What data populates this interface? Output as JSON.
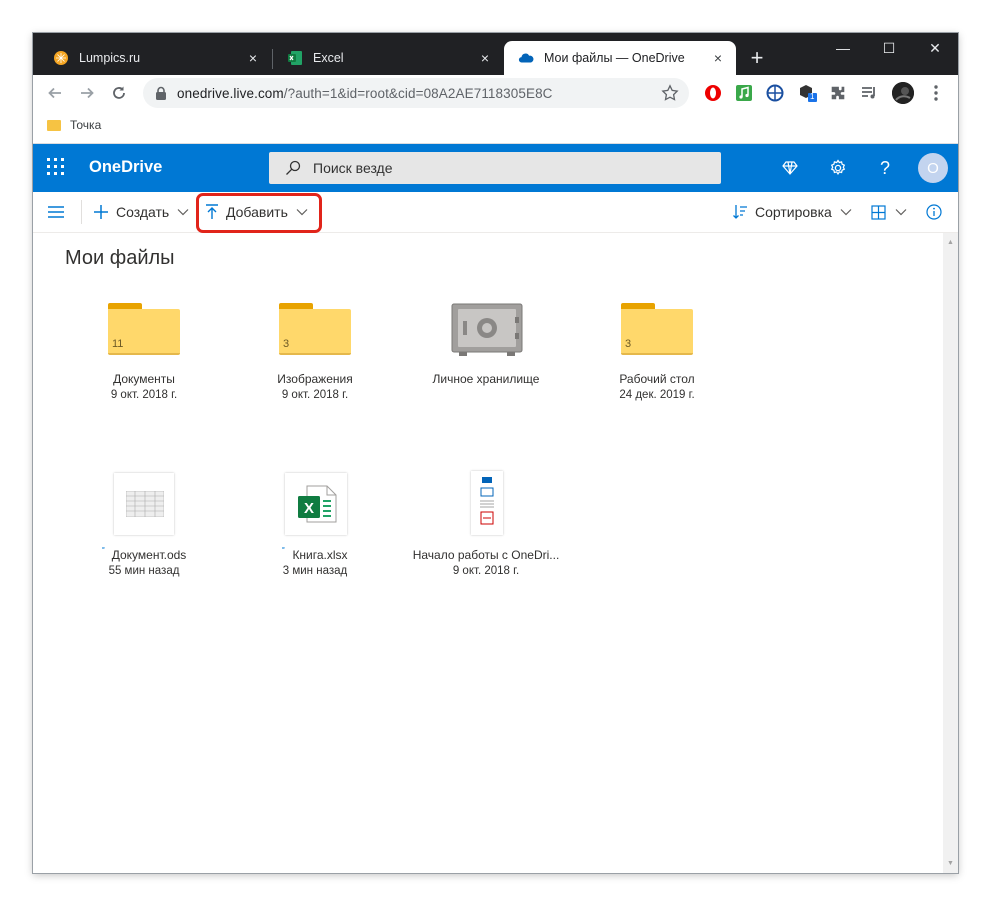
{
  "browser": {
    "tabs": [
      {
        "title": "Lumpics.ru",
        "close": "×"
      },
      {
        "title": "Excel",
        "close": "×"
      },
      {
        "title": "Мои файлы — OneDrive",
        "close": "×"
      }
    ],
    "new_tab": "+",
    "window_controls": {
      "minimize": "—",
      "maximize": "☐",
      "close": "✕"
    },
    "url_host": "onedrive.live.com",
    "url_path": "/?auth=1&id=root&cid=08A2AE7118305E8C",
    "bookmark": "Точка",
    "extension_badge": "1"
  },
  "onedrive": {
    "brand": "OneDrive",
    "search_placeholder": "Поиск везде",
    "help": "?",
    "avatar_letter": "O",
    "accent": "#0078d4"
  },
  "commands": {
    "create": "Создать",
    "upload": "Добавить",
    "sort": "Сортировка"
  },
  "page_title": "Мои файлы",
  "items": [
    {
      "name": "Документы",
      "meta": "9 окт. 2018 г.",
      "count": "11",
      "kind": "folder"
    },
    {
      "name": "Изображения",
      "meta": "9 окт. 2018 г.",
      "count": "3",
      "kind": "folder"
    },
    {
      "name": "Личное хранилище",
      "meta": "",
      "kind": "vault"
    },
    {
      "name": "Рабочий стол",
      "meta": "24 дек. 2019 г.",
      "count": "3",
      "kind": "folder"
    },
    {
      "name": "Документ.ods",
      "meta": "55 мин назад",
      "kind": "ods"
    },
    {
      "name": "Книга.xlsx",
      "meta": "3 мин назад",
      "kind": "xlsx"
    },
    {
      "name": "Начало работы с OneDri...",
      "meta": "9 окт. 2018 г.",
      "kind": "pdf"
    }
  ],
  "excel_letter": "X",
  "icons": [
    "lumpics-favicon",
    "excel-favicon",
    "onedrive-favicon",
    "back-arrow-icon",
    "forward-arrow-icon",
    "reload-icon",
    "lock-icon",
    "star-icon",
    "waffle-icon",
    "search-icon",
    "diamond-icon",
    "gear-icon",
    "hamburger-icon",
    "plus-icon",
    "upload-icon",
    "sort-icon",
    "grid-view-icon",
    "info-icon"
  ]
}
